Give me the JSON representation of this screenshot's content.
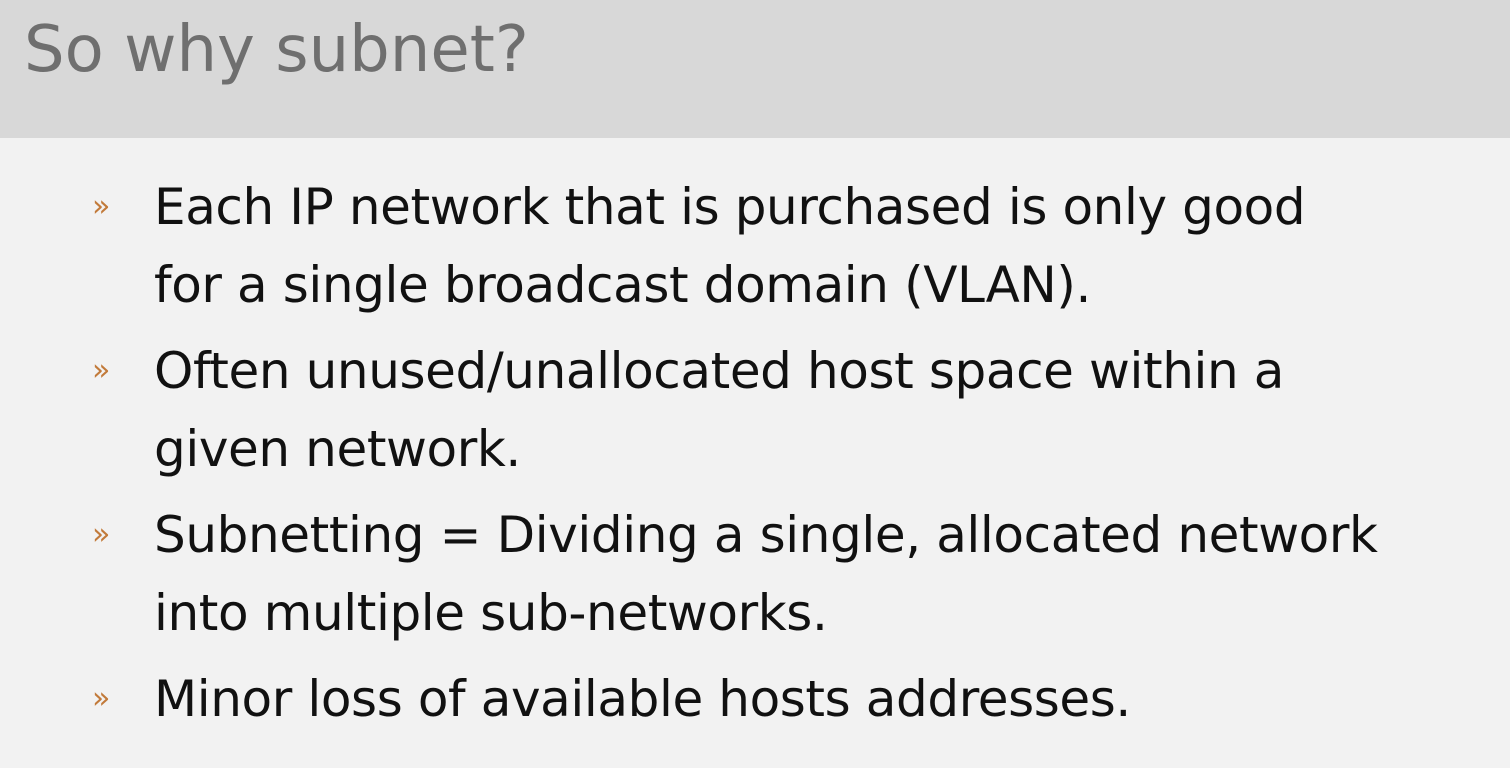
{
  "slide": {
    "title": "So why subnet?",
    "bullets": [
      {
        "marker": "»",
        "text": "Each IP network that is purchased is only good\nfor a single broadcast domain (VLAN)."
      },
      {
        "marker": "»",
        "text": "Often unused/unallocated host space within a\ngiven network."
      },
      {
        "marker": "»",
        "text": "Subnetting = Dividing a single, allocated network\ninto multiple sub-networks."
      },
      {
        "marker": "»",
        "text": "Minor loss of available hosts addresses."
      }
    ]
  },
  "colors": {
    "title_bar": "#d8d8d8",
    "background": "#f2f2f2",
    "title_text": "#6f6f6f",
    "bullet_marker": "#c27a3a",
    "body_text": "#111111"
  }
}
